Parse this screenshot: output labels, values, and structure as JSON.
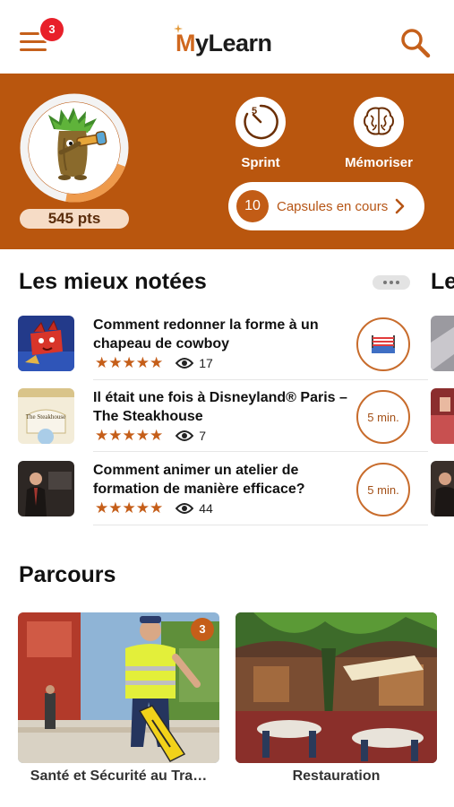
{
  "header": {
    "logo_prefix": "M",
    "logo_rest": "yLearn",
    "notifications_count": "3",
    "menu_icon": "hamburger-icon",
    "search_icon": "search-icon"
  },
  "profile": {
    "points": "545 pts",
    "progress_ring_fraction": 0.22,
    "sprint_label": "Sprint",
    "sprint_dial_number": "5",
    "memorize_label": "Mémoriser",
    "capsules_count": "10",
    "capsules_label": "Capsules en cours"
  },
  "best_rated": {
    "title": "Les mieux notées",
    "next_section_peek": "Le",
    "items": [
      {
        "title": "Comment redonner la forme à un chapeau de cowboy",
        "rating": "★★★★★",
        "views": "17",
        "badge": "",
        "badge_icon": "boxing-ring-icon"
      },
      {
        "title": "Il était une fois à Disneyland® Paris – The Steakhouse",
        "rating": "★★★★★",
        "views": "7",
        "badge": "5 min.",
        "thumb_caption": "The Steakhouse"
      },
      {
        "title": "Comment animer un atelier de formation de manière efficace?",
        "rating": "★★★★★",
        "views": "44",
        "badge": "5 min."
      }
    ]
  },
  "parcours": {
    "title": "Parcours",
    "cards": [
      {
        "label": "Santé et Sécurité au Tra…",
        "count": "3"
      },
      {
        "label": "Restauration"
      }
    ]
  },
  "colors": {
    "brand_orange": "#b9560e",
    "accent_orange": "#c55e19",
    "notification_red": "#e8202a"
  }
}
